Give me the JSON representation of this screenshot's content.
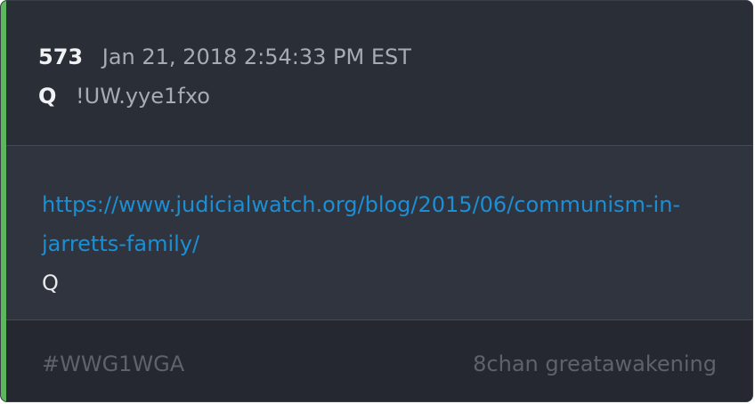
{
  "post": {
    "number": "573",
    "timestamp": "Jan 21, 2018 2:54:33 PM EST",
    "author": "Q",
    "tripcode": "!UW.yye1fxo",
    "link_line1": "https://www.judicialwatch.org/blog/2015/06/communism-in-",
    "link_line2": "jarretts-family/",
    "signature": "Q"
  },
  "footer": {
    "hashtag": "#WWG1WGA",
    "source": "8chan greatawakening"
  },
  "colors": {
    "accent": "#5cb85c",
    "link": "#1b8fd6",
    "background": "#2c3039"
  }
}
